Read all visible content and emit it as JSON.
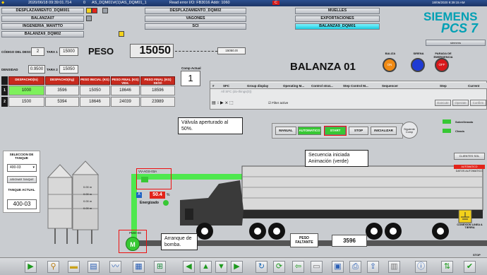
{
  "topbar": {
    "date_time": "2020/06/18  09:39:01.714",
    "index": "0",
    "tag": "AS_DQM01\\#(1)\\AS_DQM01_1",
    "error": "Read error I/O: FB3016 Addr: 1060",
    "msg": "C",
    "right_datetime": "18/06/2020 9:39:15 AM"
  },
  "nav": {
    "col1": [
      "DESPLAZAMIENTO_DQM001",
      "BALANZA07",
      "INGENERIA_MANTTO",
      "BALANZA9_DQM02"
    ],
    "col2": [
      "DESPLAZAMIENTO_DQM02",
      "VAGONES",
      "SCI"
    ],
    "col3": [
      "MUELLES",
      "EXPORTACIONES",
      "BALANZA9_DQM01"
    ],
    "user": "siemens"
  },
  "brand": {
    "name": "SIEMENS",
    "product": "PCS 7"
  },
  "params": {
    "cod_lbl": "CÓDIGO DEL DESCONEX.",
    "cod_val": "2",
    "tara_lbl": "TARA 1",
    "tara_val": "15000",
    "dens_lbl": "DENSIDAD",
    "dens_val": "0.9500",
    "tara2_lbl": "TARA 2",
    "tara2_val": "15050"
  },
  "peso": {
    "label": "PESO",
    "value": "15050",
    "small": "15050.0t"
  },
  "comp": {
    "label": "Comp Actual",
    "value": "1"
  },
  "table": {
    "headers": [
      "DESPACHO(tn)",
      "DESPACHO(Kg)",
      "PESO INICIAL (KG)",
      "PESO FINAL (KG) VEH.",
      "PESO FINAL (KG) SE(S)"
    ],
    "rows": [
      {
        "n": "1",
        "cells": [
          "1000",
          "3596",
          "15050",
          "18646",
          "18596"
        ]
      },
      {
        "n": "2",
        "cells": [
          "1500",
          "5394",
          "18646",
          "24039",
          "23989"
        ]
      }
    ]
  },
  "balanza": {
    "title": "BALANZA 01"
  },
  "indicators": [
    {
      "label": "BALIZA",
      "text": "ON",
      "color": "#f08a14"
    },
    {
      "label": "SIRENA",
      "text": "",
      "color": "#1f3bd4"
    },
    {
      "label": "PARADA DE EMERGENCIA",
      "text": "OFF",
      "color": "#d8181a"
    }
  ],
  "grid": {
    "cols": [
      "SFC",
      "Group display",
      "Operating M...",
      "Control strat...",
      "Step Control M...",
      "Sequencer",
      "Step",
      "Current"
    ],
    "row": "All SFC (do-things(0))",
    "filter_label": "Filter active",
    "buttons": [
      "Execute",
      "Operate",
      "Confirm"
    ]
  },
  "callouts": {
    "valve": "Válvula aperturado al 50%.",
    "sequence": "Secuencia iniciada Animación (verde)",
    "pump": "Arranque de bomba."
  },
  "sequence_buttons": [
    "MANUAL",
    "AUTOMATICO",
    "START",
    "STOP",
    "INICIALIZAR"
  ],
  "sequence_comp": "Siguiente Comp",
  "valve": {
    "tag": "VV-AGS-03A",
    "value": "50.4",
    "unit": "%",
    "state": "Energizado"
  },
  "pump": {
    "tag": "PMO-08"
  },
  "selector": {
    "title": "SELECCION DE TANQUE",
    "selected": "400-03",
    "assign_btn": "ASIGNAR TANQUE",
    "current_lbl": "TANQUE ACTUAL",
    "current_val": "400-03"
  },
  "silo_levels": [
    "0.00 m",
    "0.00 m",
    "0.00 m",
    "0.00 m"
  ],
  "right_panel": {
    "sob_label": "Sobrellenado",
    "cha_label": "Chasis",
    "clientes_btn": "CLIENTES SOL",
    "auto_label": "AUTOMATICO",
    "datos_label": "DATOS AUTOMATICO",
    "ground_label": "CONEXION LINEA A TIERRA",
    "stop_label": "STOP"
  },
  "faltante": {
    "label": "PESO FALTANTE",
    "value": "3596"
  },
  "toolbar_icons": [
    "play-icon",
    "filter-icon",
    "folder-icon",
    "report-icon",
    "trend-icon",
    "log-icon",
    "tree-icon",
    "arrow-left-icon",
    "arrow-up-icon",
    "arrow-down-icon",
    "arrow-right-icon",
    "refresh-icon",
    "reload-icon",
    "back-icon",
    "save-icon",
    "window-icon",
    "printer-icon",
    "export-icon",
    "trash-icon",
    "info-icon",
    "vertical-icon",
    "check-icon"
  ],
  "colors": {
    "accent_green": "#37c834",
    "pipe_green": "#4ee84e",
    "header_red": "#c82a1e",
    "siemens": "#00a0b4"
  }
}
